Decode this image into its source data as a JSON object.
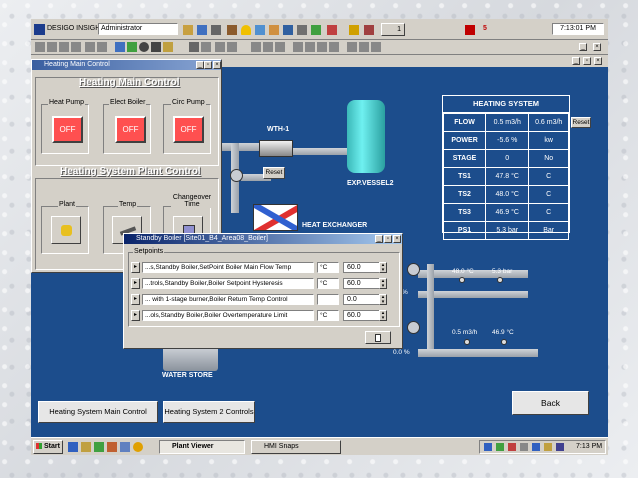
{
  "toolbar": {
    "app_name": "DESIGO INSIGHT",
    "user": "Administrator",
    "alarm_count": "5",
    "clock": "7:13:01 PM",
    "small_label": "1"
  },
  "heating_main": {
    "title": "Heating Main Control",
    "heading": "Heating Main Control",
    "buttons": [
      {
        "label": "Heat Pump",
        "state": "OFF"
      },
      {
        "label": "Elect Boiler",
        "state": "OFF"
      },
      {
        "label": "Circ Pump",
        "state": "OFF"
      }
    ],
    "plant_heading": "Heating System Plant Control",
    "plant_buttons": [
      {
        "label": "Plant"
      },
      {
        "label": "Temp"
      },
      {
        "label": "Changeover Time"
      }
    ]
  },
  "diagram": {
    "wth_label": "WTH-1",
    "vessel_label": "EXP.VESSEL2",
    "hx_label": "HEAT EXCHANGER",
    "water_store_label": "WATER STORE",
    "reset_label": "Reset",
    "readings": {
      "t1": "48.0 °C",
      "p1": "5.3 bar",
      "f1": "0.5 m3/h",
      "t2": "46.9 °C",
      "pct1": "%",
      "pct2": "0.0 %"
    }
  },
  "heating_system": {
    "title": "HEATING SYSTEM",
    "reset_label": "Reset",
    "rows": [
      {
        "label": "FLOW",
        "value": "0.5 m3/h",
        "unit": "0.6 m3/h"
      },
      {
        "label": "POWER",
        "value": "-5.6 %",
        "unit": "kw"
      },
      {
        "label": "STAGE",
        "value": "0",
        "unit": "No"
      },
      {
        "label": "TS1",
        "value": "47.8 °C",
        "unit": "C"
      },
      {
        "label": "TS2",
        "value": "48.0 °C",
        "unit": "C"
      },
      {
        "label": "TS3",
        "value": "46.9 °C",
        "unit": "C"
      },
      {
        "label": "PS1",
        "value": "5.3 bar",
        "unit": "Bar"
      }
    ]
  },
  "standby": {
    "title": "Standby Boiler [Site01_B4_Area08_Boiler]",
    "group_label": "Setpoints",
    "rows": [
      {
        "label": "...s,Standby Boiler,SetPoint Boiler Main Flow Temp",
        "unit": "°C",
        "value": "60.0"
      },
      {
        "label": "...trols,Standby Boiler,Boiler Setpoint Hysteresis",
        "unit": "°C",
        "value": "60.0"
      },
      {
        "label": "... with 1-stage burner,Boiler Return Temp Control",
        "unit": "",
        "value": "0.0"
      },
      {
        "label": "...ols,Standby Boiler,Boiler Overtemperature Limit",
        "unit": "°C",
        "value": "60.0"
      }
    ]
  },
  "bottom_buttons": {
    "main": "Heating System Main Control",
    "sys2": "Heating System 2 Controls",
    "back": "Back"
  },
  "taskbar": {
    "start": "Start",
    "task1": "Plant Viewer",
    "task2": "HMI Snaps",
    "clock": "7:13 PM"
  },
  "colors": {
    "screen_bg": "#1c4d8c",
    "off_button": "#ff5050",
    "window_gray": "#d4d0c8"
  }
}
